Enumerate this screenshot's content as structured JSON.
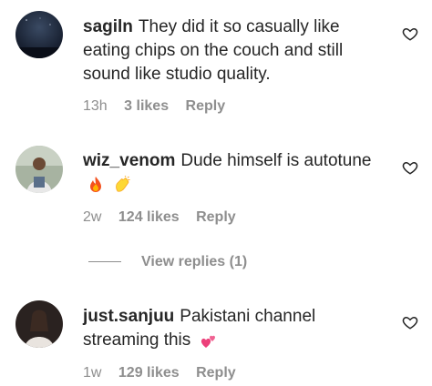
{
  "comments": [
    {
      "username": "sagiln",
      "text": "They did it so casually like eating chips on the couch and still sound like studio quality.",
      "time": "13h",
      "likes": "3 likes",
      "reply": "Reply",
      "avatar_icon": "night-sky-avatar-icon"
    },
    {
      "username": "wiz_venom",
      "text": "Dude himself is autotune",
      "emojis": [
        "fire-emoji",
        "clapping-hands-emoji"
      ],
      "time": "2w",
      "likes": "124 likes",
      "reply": "Reply",
      "avatar_icon": "person-photo-avatar-icon"
    },
    {
      "username": "just.sanjuu",
      "text": "Pakistani channel streaming this",
      "emojis": [
        "two-hearts-emoji"
      ],
      "time": "1w",
      "likes": "129 likes",
      "reply": "Reply",
      "avatar_icon": "person-photo-avatar-icon"
    }
  ],
  "view_replies": "View replies (1)",
  "colors": {
    "text": "#262626",
    "muted": "#8e8e8e",
    "background": "#ffffff",
    "heart_stroke": "#262626"
  }
}
